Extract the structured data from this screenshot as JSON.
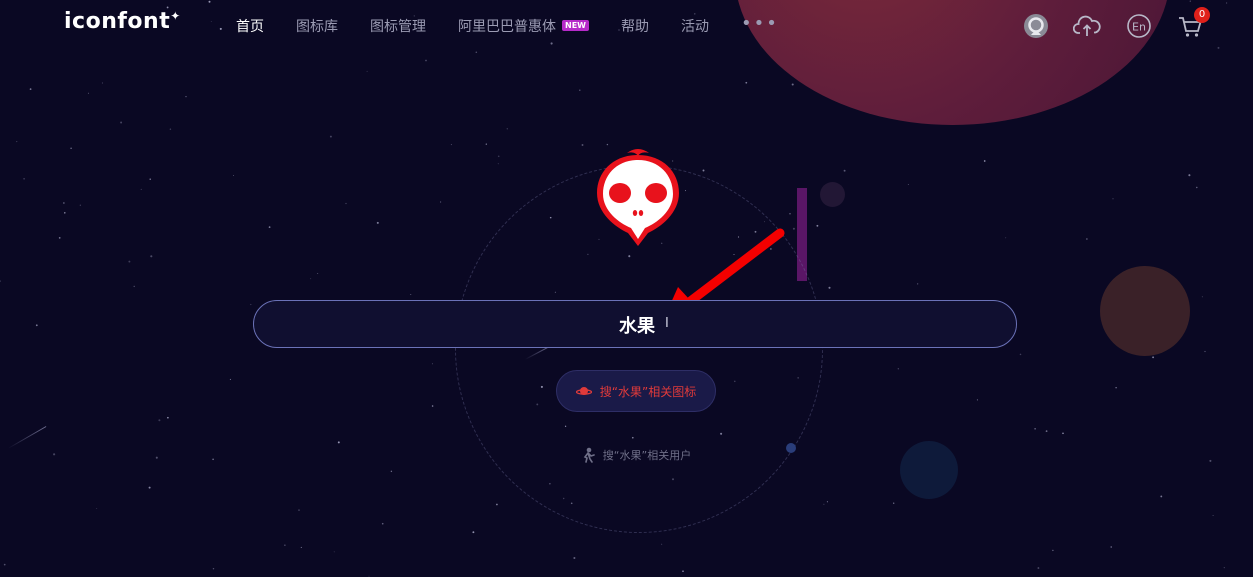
{
  "brand": {
    "logo": "iconfont",
    "logo_mark": "✦"
  },
  "nav": {
    "items": [
      {
        "label": "首页",
        "active": true
      },
      {
        "label": "图标库"
      },
      {
        "label": "图标管理"
      },
      {
        "label": "阿里巴巴普惠体",
        "badge": "NEW"
      },
      {
        "label": "帮助"
      },
      {
        "label": "活动"
      }
    ],
    "more": "•••"
  },
  "header_icons": {
    "cart_count": "0",
    "icons": [
      "avatar-icon",
      "upload-cloud-icon",
      "language-en-icon",
      "cart-icon"
    ],
    "language": "En"
  },
  "search": {
    "value": "水果"
  },
  "actions": {
    "search_icons": "搜“水果”相关图标",
    "search_users": "搜“水果”相关用户"
  },
  "colors": {
    "background": "#0a0823",
    "accent_red": "#e0201a",
    "badge_purple": "#b62ac9",
    "search_border": "#6b72b8"
  }
}
